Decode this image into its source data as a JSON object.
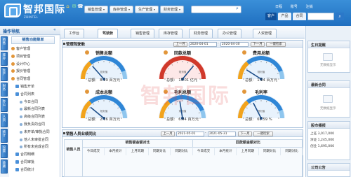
{
  "brand": {
    "name": "智邦国际",
    "sub": "ZBINTEL"
  },
  "header": {
    "menus": [
      {
        "label": "销售管理"
      },
      {
        "label": "库存管理"
      },
      {
        "label": "生产管理"
      },
      {
        "label": "财务管理"
      }
    ],
    "search_placeholder": "",
    "links": [
      "日程",
      "账号",
      "注销"
    ],
    "tabs": [
      "客户",
      "产品",
      "合同"
    ]
  },
  "sidebar": {
    "title": "操作导航",
    "vtabs": [
      "销售",
      "库存",
      "生产",
      "财务",
      "办公",
      "人资",
      "统计",
      "设置",
      "收藏"
    ],
    "top_button": "销售功能菜单",
    "items": [
      {
        "label": "客户管理",
        "level": 0
      },
      {
        "label": "项目管理",
        "level": 0
      },
      {
        "label": "设计中心",
        "level": 0
      },
      {
        "label": "报价管理",
        "level": 0
      },
      {
        "label": "合同管理",
        "level": 0
      },
      {
        "label": "销售开单",
        "level": 1
      },
      {
        "label": "合同列表",
        "level": 1
      },
      {
        "label": "今日合同",
        "level": 2
      },
      {
        "label": "最新合同列表",
        "level": 2
      },
      {
        "label": "高级合同列表",
        "level": 2
      },
      {
        "label": "我负责的合同",
        "level": 2
      },
      {
        "label": "未开单/审批合同",
        "level": 2
      },
      {
        "label": "他人未审批合同",
        "level": 2
      },
      {
        "label": "所有未完成合同",
        "level": 2
      },
      {
        "label": "合同明细",
        "level": 1
      },
      {
        "label": "合同审批",
        "level": 1
      },
      {
        "label": "合同统计",
        "level": 1
      }
    ]
  },
  "tabs": [
    "工作台",
    "驾驶舱",
    "销售管理",
    "库存管理",
    "财务管理",
    "办公管理",
    "人资管理"
  ],
  "dashboard": {
    "title": "管理驾驶舱",
    "prev": "上一月",
    "date_from": "2020-04-01",
    "date_to": "2020-04-30",
    "next": "下一月",
    "query": "一键检索"
  },
  "gauges": [
    {
      "title": "销售总额",
      "value_label": "总额：",
      "value": "8.19",
      "unit": "百万元",
      "level": 0.27,
      "theme": "blue"
    },
    {
      "title": "回款总额",
      "value_label": "总额：",
      "value": "13.01",
      "unit": "亿元",
      "level": 0.72,
      "theme": "red"
    },
    {
      "title": "费用总额",
      "value_label": "总额：",
      "value": "1.14",
      "unit": "百万元",
      "level": 0.18,
      "theme": "blue"
    },
    {
      "title": "成本总额",
      "value_label": "总额：",
      "value": "2.16",
      "unit": "百万元",
      "level": 0.22,
      "theme": "blue"
    },
    {
      "title": "毛利总额",
      "value_label": "总额：",
      "value": "6.04",
      "unit": "百万元",
      "level": 0.45,
      "theme": "blue"
    },
    {
      "title": "毛利率",
      "value_label": "总额：",
      "value": "61.59",
      "unit": "%",
      "level": 0.35,
      "theme": "blue"
    }
  ],
  "gauge_center_text": "规划值",
  "table": {
    "title": "销售人员业绩同比",
    "prev": "上一月",
    "date_from": "2021-05-01",
    "date_to": "2021-05-31",
    "next": "下一月",
    "query": "一键检索",
    "col_person": "销售人员",
    "group1": "销售额金额对比",
    "group2": "回款额金额对比",
    "cols": [
      "今日成交",
      "本月统计",
      "上月同期",
      "同期对比",
      "同期对比",
      "今日成交",
      "本月统计",
      "上月同期",
      "同期对比",
      "同期对比"
    ]
  },
  "right": {
    "birthday": {
      "title": "生日提醒",
      "empty": "无数据显示"
    },
    "contract": {
      "title": "最新合同",
      "empty": "无数据显示"
    },
    "stock": {
      "title": "股市播报",
      "rows": [
        {
          "name": "上证",
          "value": "3,017,000"
        },
        {
          "name": "深证",
          "value": "1,245,000"
        },
        {
          "name": "创业",
          "value": "1,695,000"
        }
      ]
    },
    "notice": {
      "title": "公司公告"
    }
  },
  "watermark": "智邦国际"
}
